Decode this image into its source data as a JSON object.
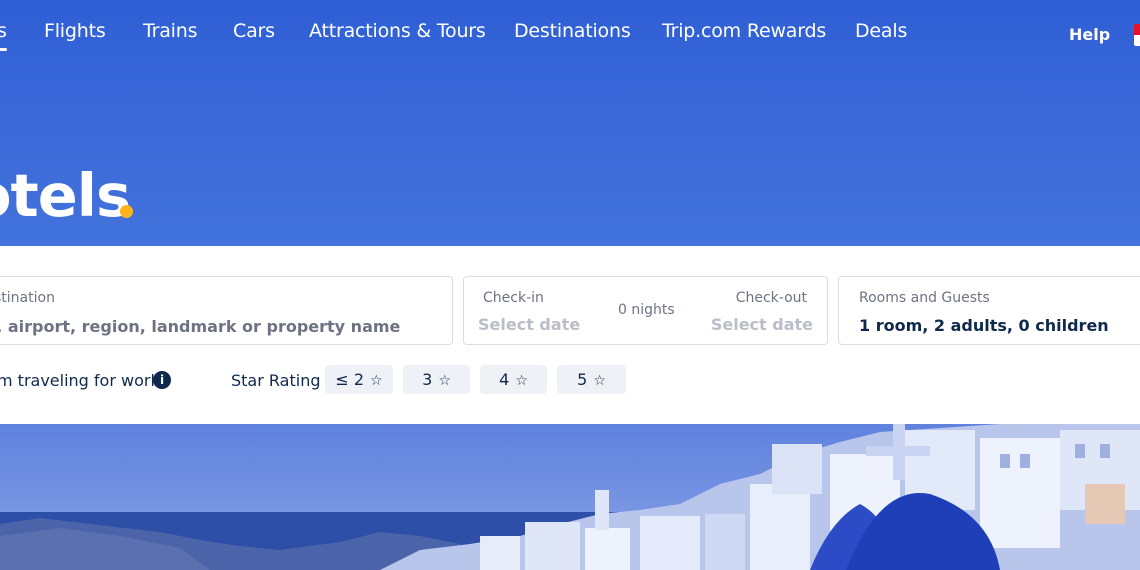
{
  "nav": {
    "items": [
      {
        "label": "s",
        "active": true
      },
      {
        "label": "Flights"
      },
      {
        "label": "Trains"
      },
      {
        "label": "Cars"
      },
      {
        "label": "Attractions & Tours"
      },
      {
        "label": "Destinations"
      },
      {
        "label": "Trip.com Rewards"
      },
      {
        "label": "Deals"
      }
    ],
    "help_label": "Help"
  },
  "hero": {
    "title": "otels"
  },
  "search": {
    "destination_label": "stination",
    "destination_placeholder": "y, airport, region, landmark or property name",
    "checkin_label": "Check-in",
    "checkin_value": "Select date",
    "nights_label": "0 nights",
    "checkout_label": "Check-out",
    "checkout_value": "Select date",
    "guests_label": "Rooms and Guests",
    "guests_value": "1 room, 2 adults, 0 children",
    "work_label": "m traveling for work",
    "star_rating_label": "Star Rating",
    "star_options": [
      "≤ 2",
      "3",
      "4",
      "5"
    ]
  },
  "colors": {
    "hero_blue": "#3a68d8",
    "accent_dot": "#ffb31a",
    "text_dark": "#0f294d"
  }
}
